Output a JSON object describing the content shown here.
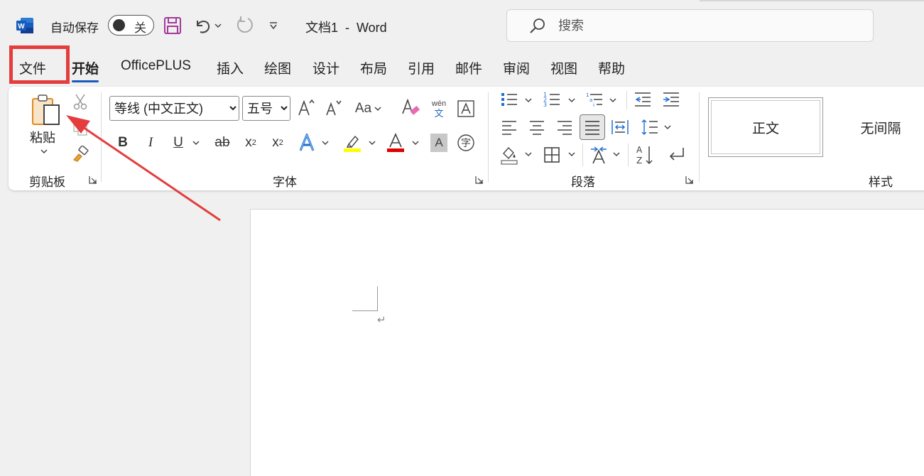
{
  "titlebar": {
    "autosave_label": "自动保存",
    "autosave_state": "关",
    "doc_title": "文档1  -  Word",
    "search_placeholder": "搜索"
  },
  "tabs": [
    {
      "label": "文件"
    },
    {
      "label": "开始"
    },
    {
      "label": "OfficePLUS"
    },
    {
      "label": "插入"
    },
    {
      "label": "绘图"
    },
    {
      "label": "设计"
    },
    {
      "label": "布局"
    },
    {
      "label": "引用"
    },
    {
      "label": "邮件"
    },
    {
      "label": "审阅"
    },
    {
      "label": "视图"
    },
    {
      "label": "帮助"
    }
  ],
  "ribbon": {
    "clipboard": {
      "paste_label": "粘贴",
      "group_label": "剪贴板"
    },
    "font": {
      "font_name": "等线 (中文正文)",
      "font_size": "五号",
      "group_label": "字体",
      "phonetic_top": "wén",
      "phonetic_bottom": "文",
      "enclose_char": "字",
      "case_label": "Aa"
    },
    "paragraph": {
      "group_label": "段落"
    },
    "styles": {
      "items": [
        "正文",
        "无间隔"
      ],
      "group_label": "样式"
    }
  },
  "colors": {
    "accent": "#185abd",
    "highlight_box": "#e43d3d",
    "arrow": "#e43d3d",
    "font_color": "#e00000",
    "highlight_color": "#ffff00"
  }
}
